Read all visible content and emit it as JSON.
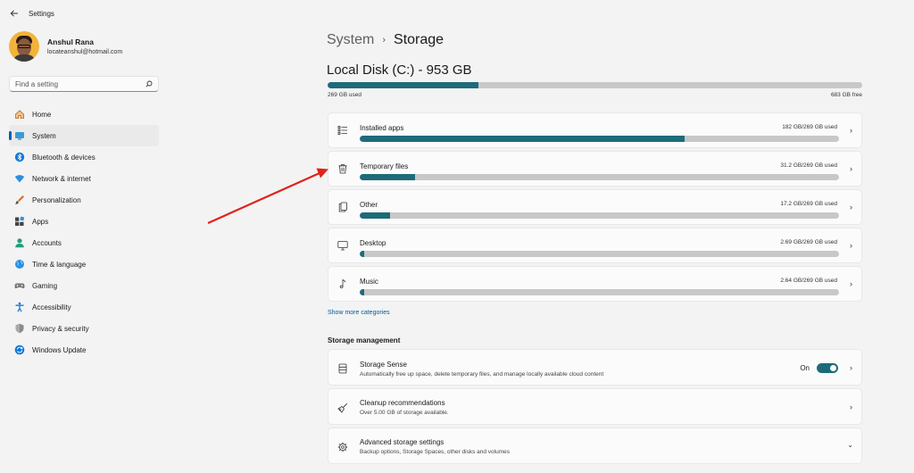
{
  "window": {
    "title": "Settings"
  },
  "profile": {
    "name": "Anshul Rana",
    "email": "locateanshul@hotmail.com"
  },
  "search": {
    "placeholder": "Find a setting"
  },
  "nav": {
    "items": [
      {
        "label": "Home",
        "icon": "home-icon"
      },
      {
        "label": "System",
        "icon": "system-icon",
        "active": true
      },
      {
        "label": "Bluetooth & devices",
        "icon": "bluetooth-icon"
      },
      {
        "label": "Network & internet",
        "icon": "wifi-icon"
      },
      {
        "label": "Personalization",
        "icon": "brush-icon"
      },
      {
        "label": "Apps",
        "icon": "apps-icon"
      },
      {
        "label": "Accounts",
        "icon": "accounts-icon"
      },
      {
        "label": "Time & language",
        "icon": "globe-icon"
      },
      {
        "label": "Gaming",
        "icon": "controller-icon"
      },
      {
        "label": "Accessibility",
        "icon": "accessibility-icon"
      },
      {
        "label": "Privacy & security",
        "icon": "shield-icon"
      },
      {
        "label": "Windows Update",
        "icon": "update-icon"
      }
    ]
  },
  "breadcrumb": {
    "parent": "System",
    "separator": "›",
    "current": "Storage"
  },
  "disk": {
    "title": "Local Disk (C:) - 953 GB",
    "used_label": "269 GB used",
    "free_label": "683 GB free",
    "used_fraction": 0.282
  },
  "categories": [
    {
      "label": "Installed apps",
      "size": "182 GB/269 GB used",
      "fraction": 0.677,
      "icon": "list-icon"
    },
    {
      "label": "Temporary files",
      "size": "31.2 GB/269 GB used",
      "fraction": 0.116,
      "icon": "trash-icon"
    },
    {
      "label": "Other",
      "size": "17.2 GB/269 GB used",
      "fraction": 0.064,
      "icon": "documents-icon"
    },
    {
      "label": "Desktop",
      "size": "2.69 GB/269 GB used",
      "fraction": 0.01,
      "icon": "monitor-icon"
    },
    {
      "label": "Music",
      "size": "2.64 GB/269 GB used",
      "fraction": 0.01,
      "icon": "music-icon"
    }
  ],
  "show_more": "Show more categories",
  "storage_management": {
    "title": "Storage management",
    "storage_sense": {
      "title": "Storage Sense",
      "desc": "Automatically free up space, delete temporary files, and manage locally available cloud content",
      "toggle_label": "On",
      "toggle_on": true
    },
    "cleanup": {
      "title": "Cleanup recommendations",
      "desc": "Over 5.00 GB of storage available."
    },
    "advanced": {
      "title": "Advanced storage settings",
      "desc": "Backup options, Storage Spaces, other disks and volumes"
    }
  },
  "colors": {
    "accent": "#1d6b7a",
    "arrow": "#e0211c",
    "nav_indicator": "#005fb8"
  }
}
